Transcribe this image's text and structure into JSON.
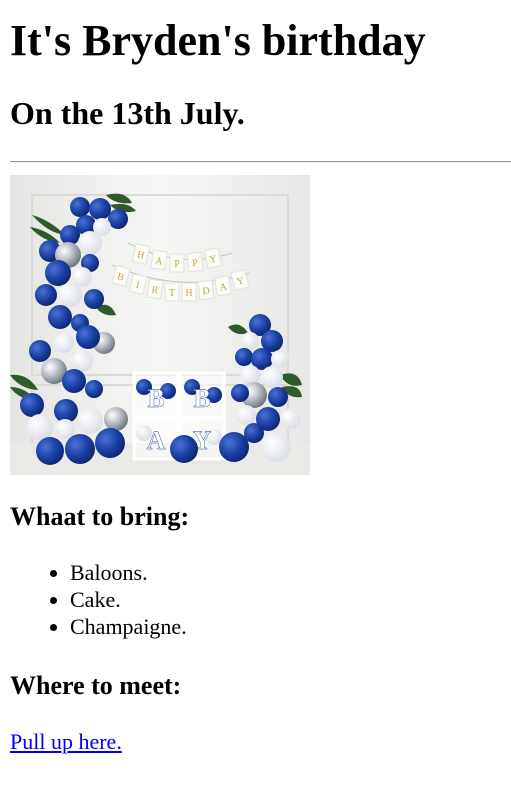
{
  "page": {
    "title": "It's Bryden's birthday",
    "date_line": "On the 13th July."
  },
  "photo": {
    "banner_letters_top": "HAPPY",
    "banner_letters_bottom": "BIRTHDAY",
    "box_letters": [
      "B",
      "B",
      "A",
      "Y"
    ],
    "colors": {
      "wall": "#f2f2f0",
      "balloon_blue": "#1a3fa0",
      "balloon_white": "#f4f6fa",
      "balloon_silver": "#c9cdd4",
      "leaf": "#2f5a2a",
      "banner_text": "#c9a640"
    }
  },
  "bring": {
    "heading": "Whaat to bring:",
    "items": [
      "Baloons.",
      "Cake.",
      "Champaigne."
    ]
  },
  "meet": {
    "heading": "Where to meet:",
    "link_text": "Pull up here."
  }
}
